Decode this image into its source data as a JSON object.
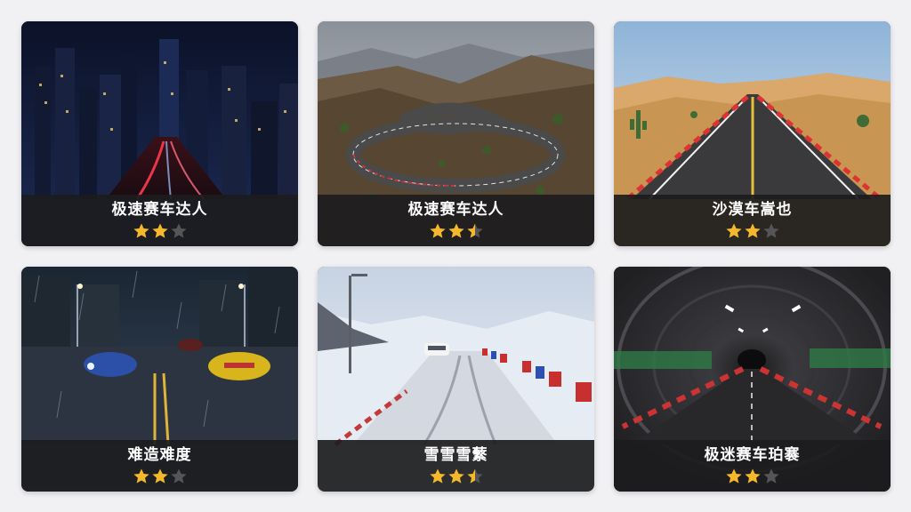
{
  "cards": [
    {
      "title": "极速赛车达人",
      "rating": 2,
      "max_rating": 3,
      "scene": "night-city-icon"
    },
    {
      "title": "极速赛车达人",
      "rating": 2.5,
      "max_rating": 3,
      "scene": "mountain-road-icon"
    },
    {
      "title": "沙漠车嵩也",
      "rating": 2,
      "max_rating": 3,
      "scene": "desert-road-icon"
    },
    {
      "title": "难造难度",
      "rating": 2,
      "max_rating": 3,
      "scene": "rainy-street-icon"
    },
    {
      "title": "雪雪雪蘩",
      "rating": 2.5,
      "max_rating": 3,
      "scene": "snow-road-icon"
    },
    {
      "title": "极迷赛车珀褰",
      "rating": 2,
      "max_rating": 3,
      "scene": "tunnel-icon"
    }
  ],
  "colors": {
    "star_filled": "#f5b82a",
    "star_empty": "#555558",
    "label_bg": "#1c1c1e",
    "page_bg": "#f1f1f4"
  }
}
